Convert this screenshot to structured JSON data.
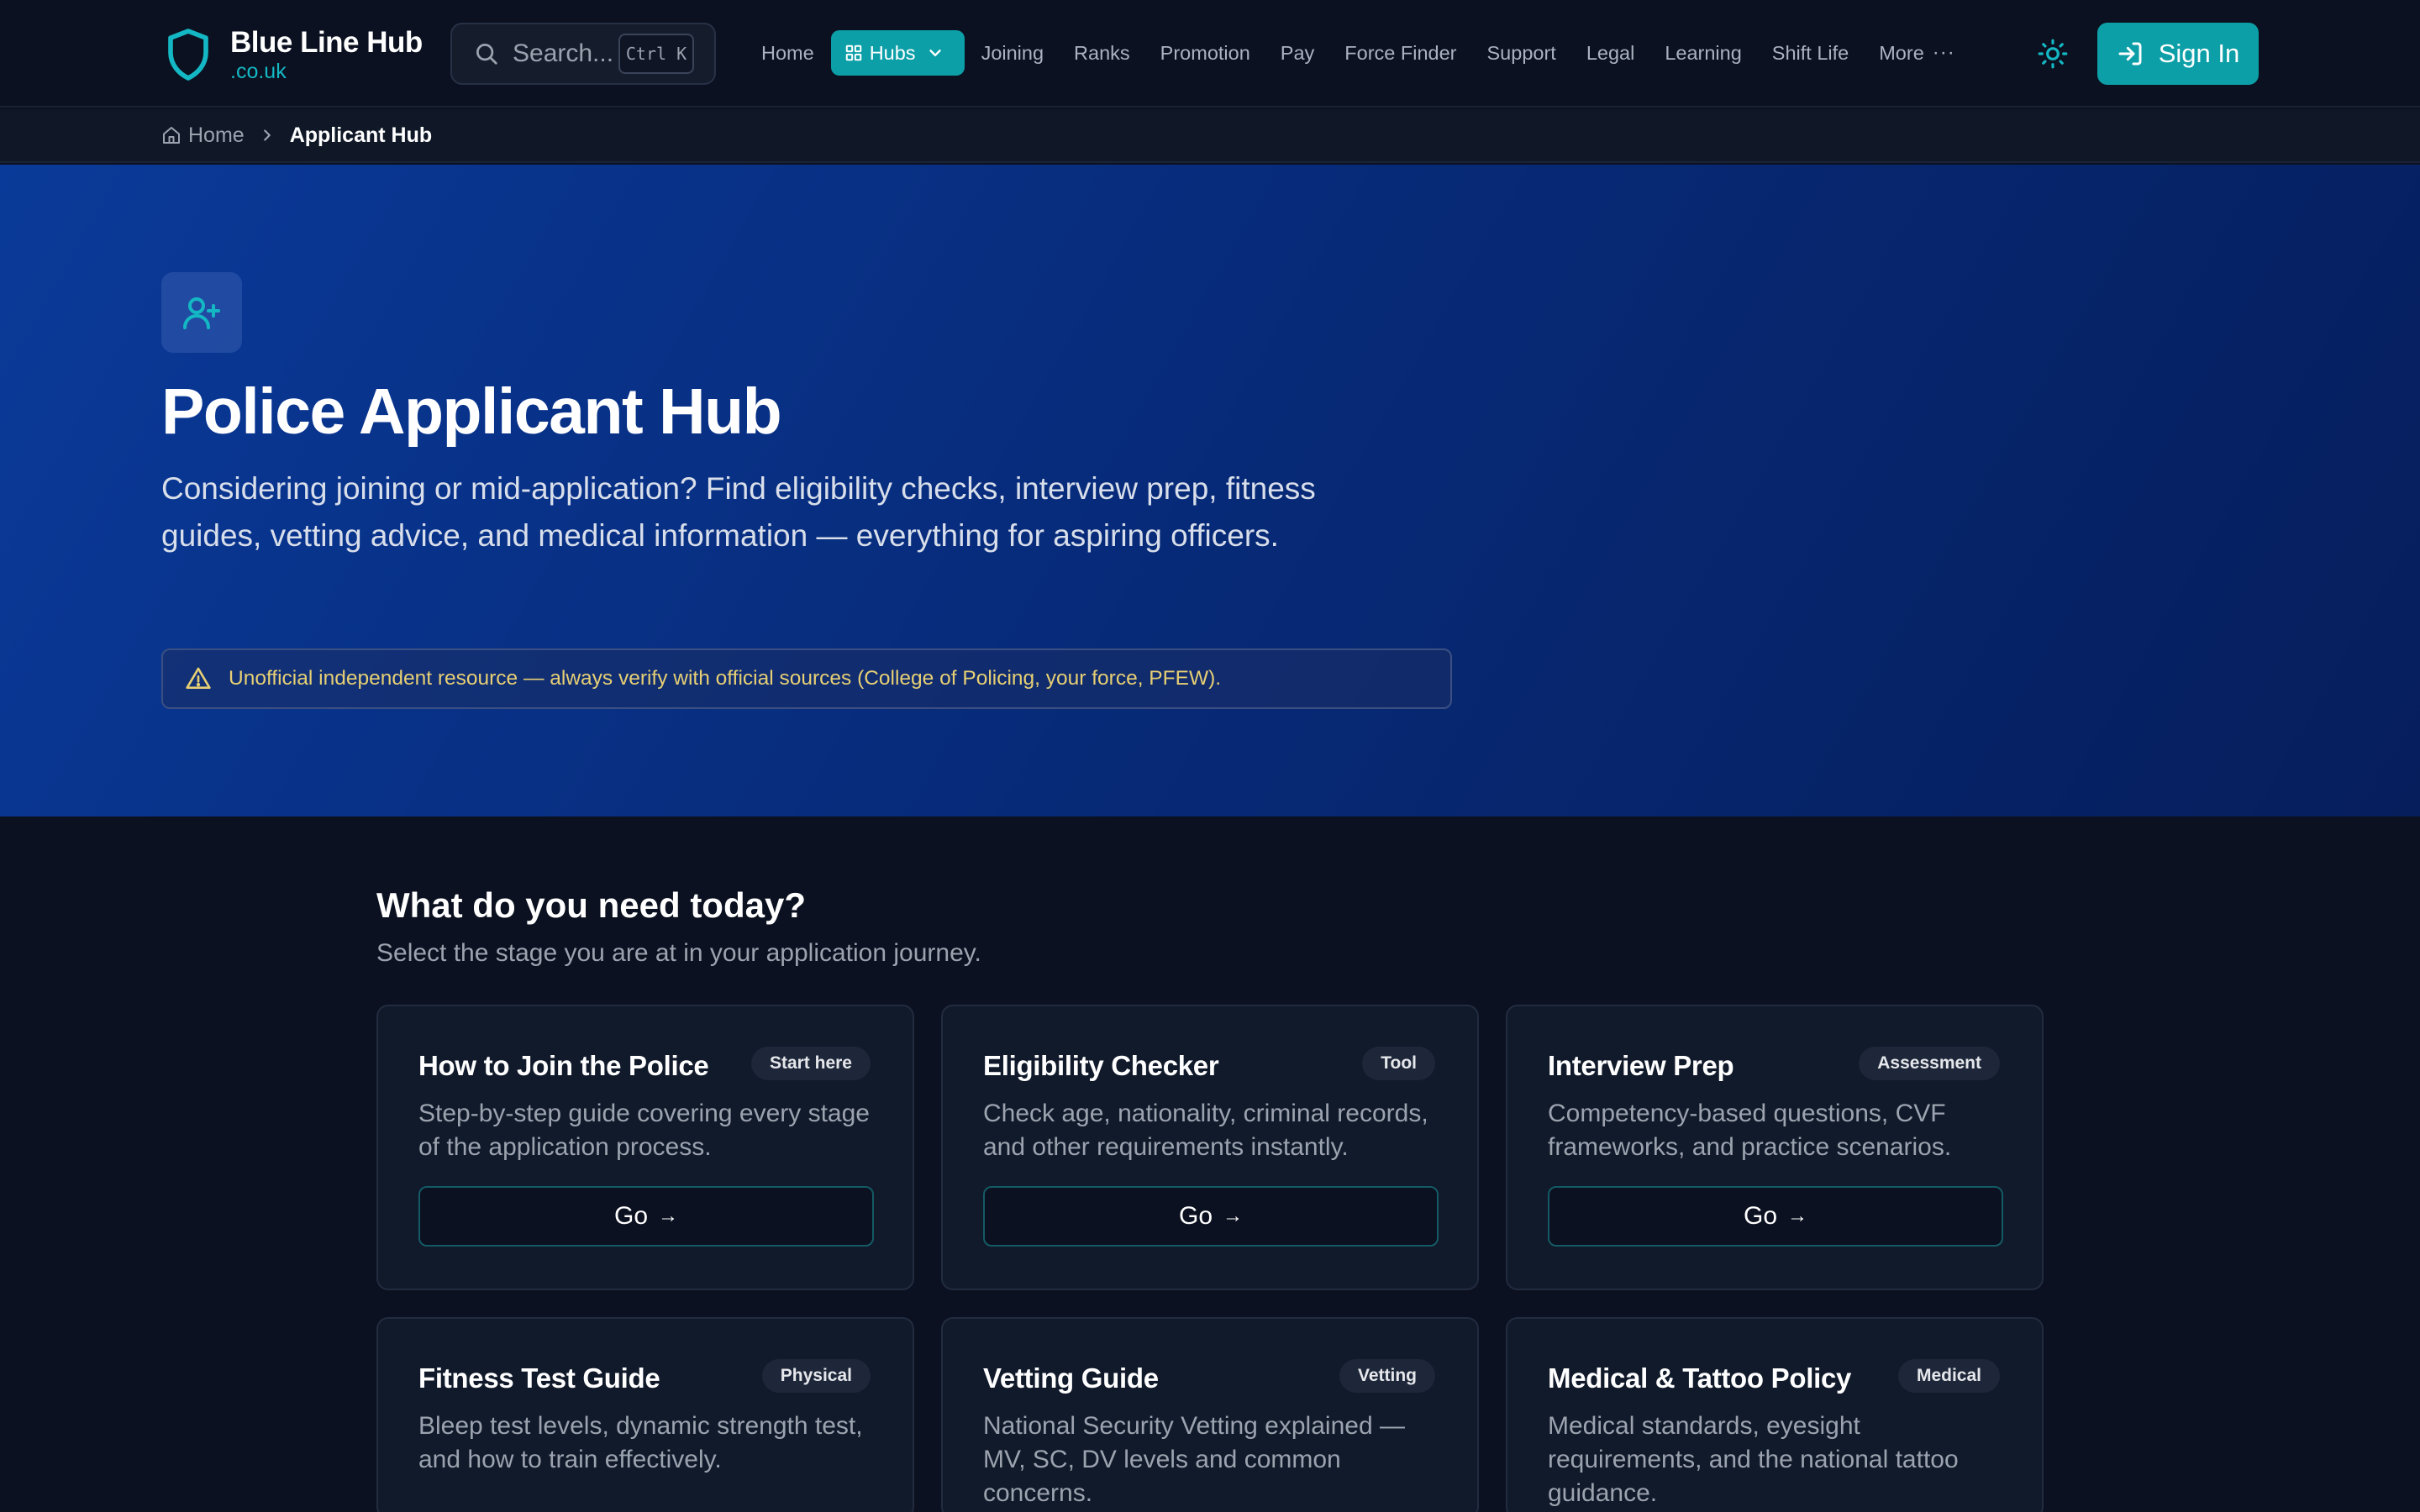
{
  "brand": {
    "name": "Blue Line Hub",
    "domain": ".co.uk",
    "accent": "#0d9fa8"
  },
  "search": {
    "placeholder": "Search...",
    "shortcut": "Ctrl K"
  },
  "nav": {
    "items": [
      {
        "label": "Home"
      },
      {
        "label": "Hubs",
        "active": true
      },
      {
        "label": "Joining"
      },
      {
        "label": "Ranks"
      },
      {
        "label": "Promotion"
      },
      {
        "label": "Pay"
      },
      {
        "label": "Force Finder"
      },
      {
        "label": "Support"
      },
      {
        "label": "Legal"
      },
      {
        "label": "Learning"
      },
      {
        "label": "Shift Life"
      },
      {
        "label": "More"
      }
    ],
    "sign_in": "Sign In"
  },
  "breadcrumb": {
    "home": "Home",
    "current": "Applicant Hub"
  },
  "hero": {
    "title": "Police Applicant Hub",
    "description": "Considering joining or mid-application? Find eligibility checks, interview prep, fitness guides, vetting advice, and medical information — everything for aspiring officers.",
    "notice": "Unofficial independent resource — always verify with official sources (College of Policing, your force, PFEW)."
  },
  "main": {
    "title": "What do you need today?",
    "subtitle": "Select the stage you are at in your application journey.",
    "go_label": "Go",
    "cards": [
      {
        "title": "How to Join the Police",
        "badge": "Start here",
        "description": "Step-by-step guide covering every stage of the application process."
      },
      {
        "title": "Eligibility Checker",
        "badge": "Tool",
        "description": "Check age, nationality, criminal records, and other requirements instantly."
      },
      {
        "title": "Interview Prep",
        "badge": "Assessment",
        "description": "Competency-based questions, CVF frameworks, and practice scenarios."
      },
      {
        "title": "Fitness Test Guide",
        "badge": "Physical",
        "description": "Bleep test levels, dynamic strength test, and how to train effectively."
      },
      {
        "title": "Vetting Guide",
        "badge": "Vetting",
        "description": "National Security Vetting explained — MV, SC, DV levels and common concerns."
      },
      {
        "title": "Medical & Tattoo Policy",
        "badge": "Medical",
        "description": "Medical standards, eyesight requirements, and the national tattoo guidance."
      }
    ]
  }
}
